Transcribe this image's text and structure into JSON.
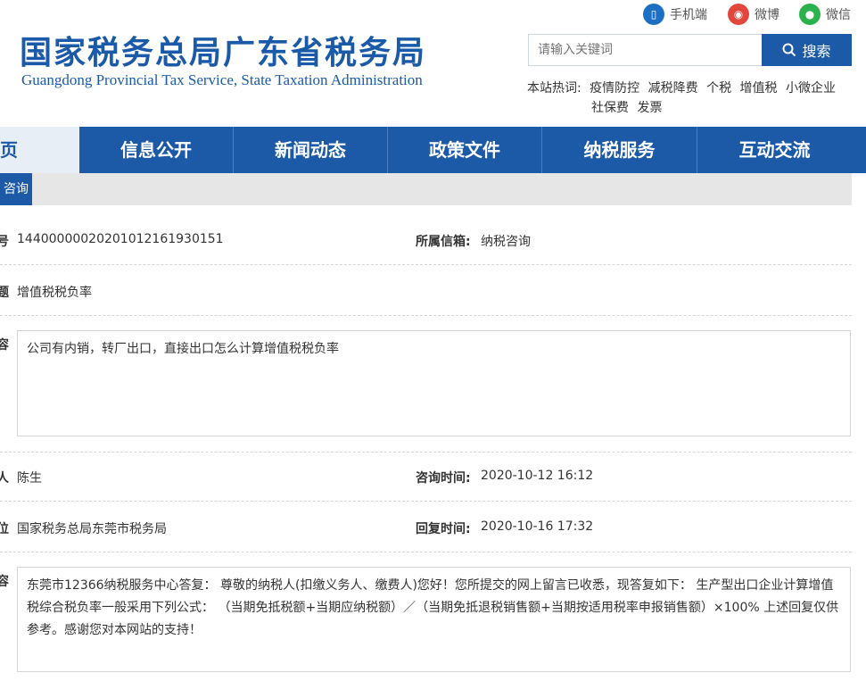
{
  "header": {
    "title_cn": "国家税务总局广东省税务局",
    "title_en": "Guangdong Provincial Tax Service, State Taxation Administration",
    "social": [
      {
        "label": "手机端",
        "icon": "mobile-icon",
        "color": "#1c6fc4"
      },
      {
        "label": "微博",
        "icon": "weibo-icon",
        "color": "#e2453c"
      },
      {
        "label": "微信",
        "icon": "wechat-icon",
        "color": "#2bb24c"
      }
    ],
    "search_placeholder": "请输入关键词",
    "search_button": "搜索",
    "hot_label": "本站热词:",
    "hot_words": [
      "疫情防控",
      "减税降费",
      "个税",
      "增值税",
      "小微企业",
      "社保费",
      "发票"
    ]
  },
  "nav": {
    "items": [
      "首页",
      "信息公开",
      "新闻动态",
      "政策文件",
      "纳税服务",
      "互动交流"
    ],
    "subtab": "咨询"
  },
  "detail": {
    "number_label_cut": "号",
    "number_value": "14400000020201012161930151",
    "mailbox_label": "所属信箱:",
    "mailbox_value": "纳税咨询",
    "subject_label_cut": "题",
    "subject_value": "增值税税负率",
    "content_label_cut": "容",
    "content_value": "公司有内销，转厂出口，直接出口怎么计算增值税税负率",
    "person_label_cut": "人",
    "person_value": "陈生",
    "consult_time_label": "咨询时间:",
    "consult_time_value": "2020-10-12 16:12",
    "unit_label_cut": "位",
    "unit_value": "国家税务总局东莞市税务局",
    "reply_time_label": "回复时间:",
    "reply_time_value": "2020-10-16 17:32",
    "reply_label_cut": "容",
    "reply_value": "东莞市12366纳税服务中心答复： 尊敬的纳税人(扣缴义务人、缴费人)您好！您所提交的网上留言已收悉，现答复如下： 生产型出口企业计算增值税综合税负率一般采用下列公式： （当期免抵税额+当期应纳税额）／（当期免抵退税销售额+当期按适用税率申报销售额）×100% 上述回复仅供参考。感谢您对本网站的支持！"
  }
}
